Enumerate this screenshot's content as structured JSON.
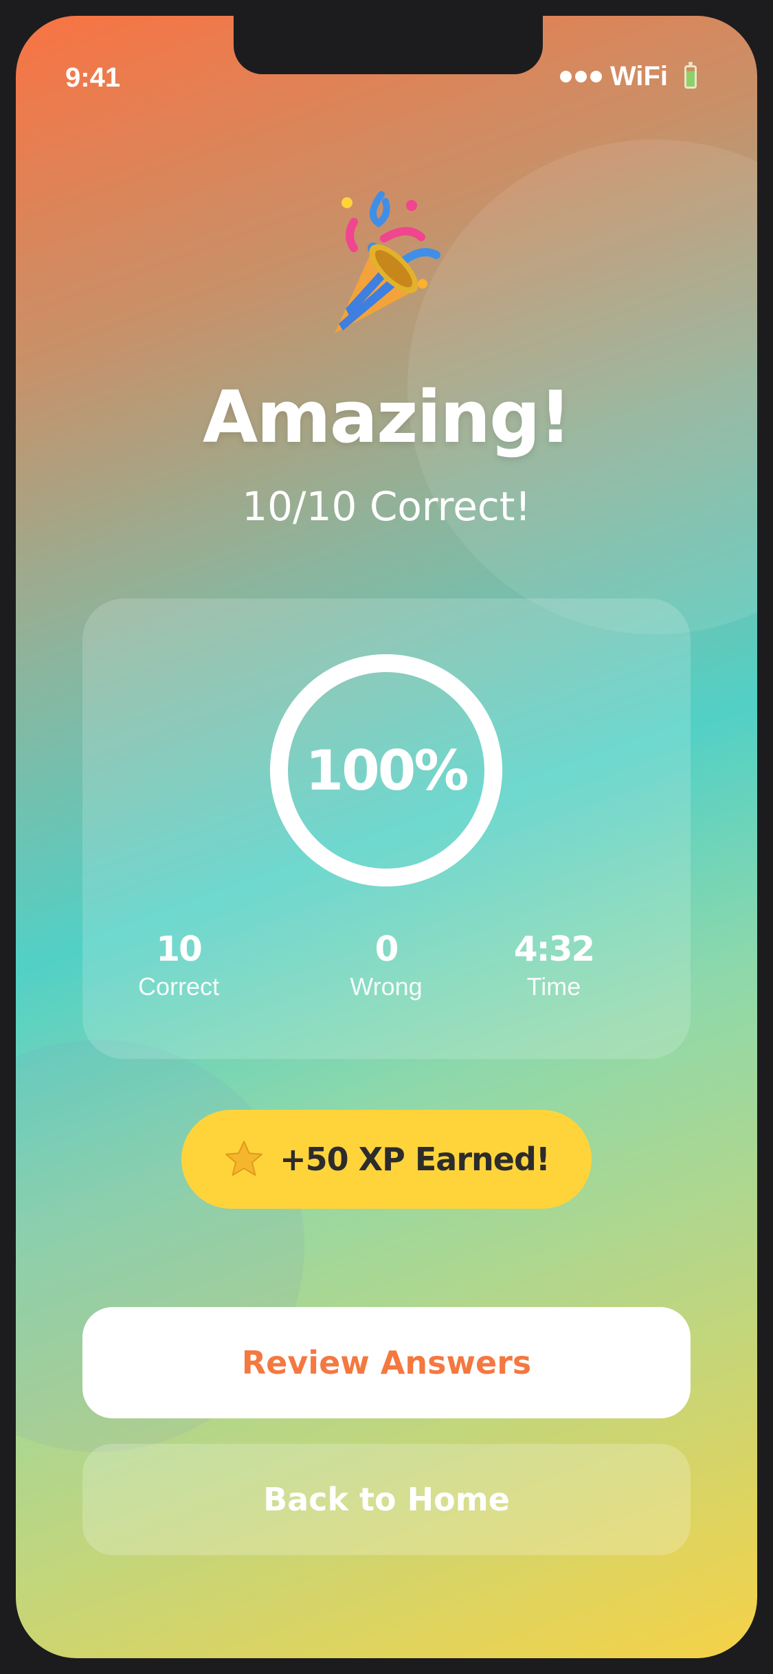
{
  "status_bar": {
    "time": "9:41",
    "network": "WiFi"
  },
  "header": {
    "icon": "party-popper-icon",
    "title": "Amazing!",
    "subtitle": "10/10 Correct!"
  },
  "score_card": {
    "percent_label": "100%",
    "percent_value": 100,
    "stats": [
      {
        "value": "10",
        "label": "Correct"
      },
      {
        "value": "0",
        "label": "Wrong"
      },
      {
        "value": "4:32",
        "label": "Time"
      }
    ]
  },
  "xp_badge": {
    "icon": "star-icon",
    "text": "+50 XP Earned!"
  },
  "actions": {
    "review_label": "Review Answers",
    "home_label": "Back to Home"
  },
  "colors": {
    "accent_orange": "#f47840",
    "badge_yellow": "#ffd43b",
    "text_white": "#ffffff"
  }
}
